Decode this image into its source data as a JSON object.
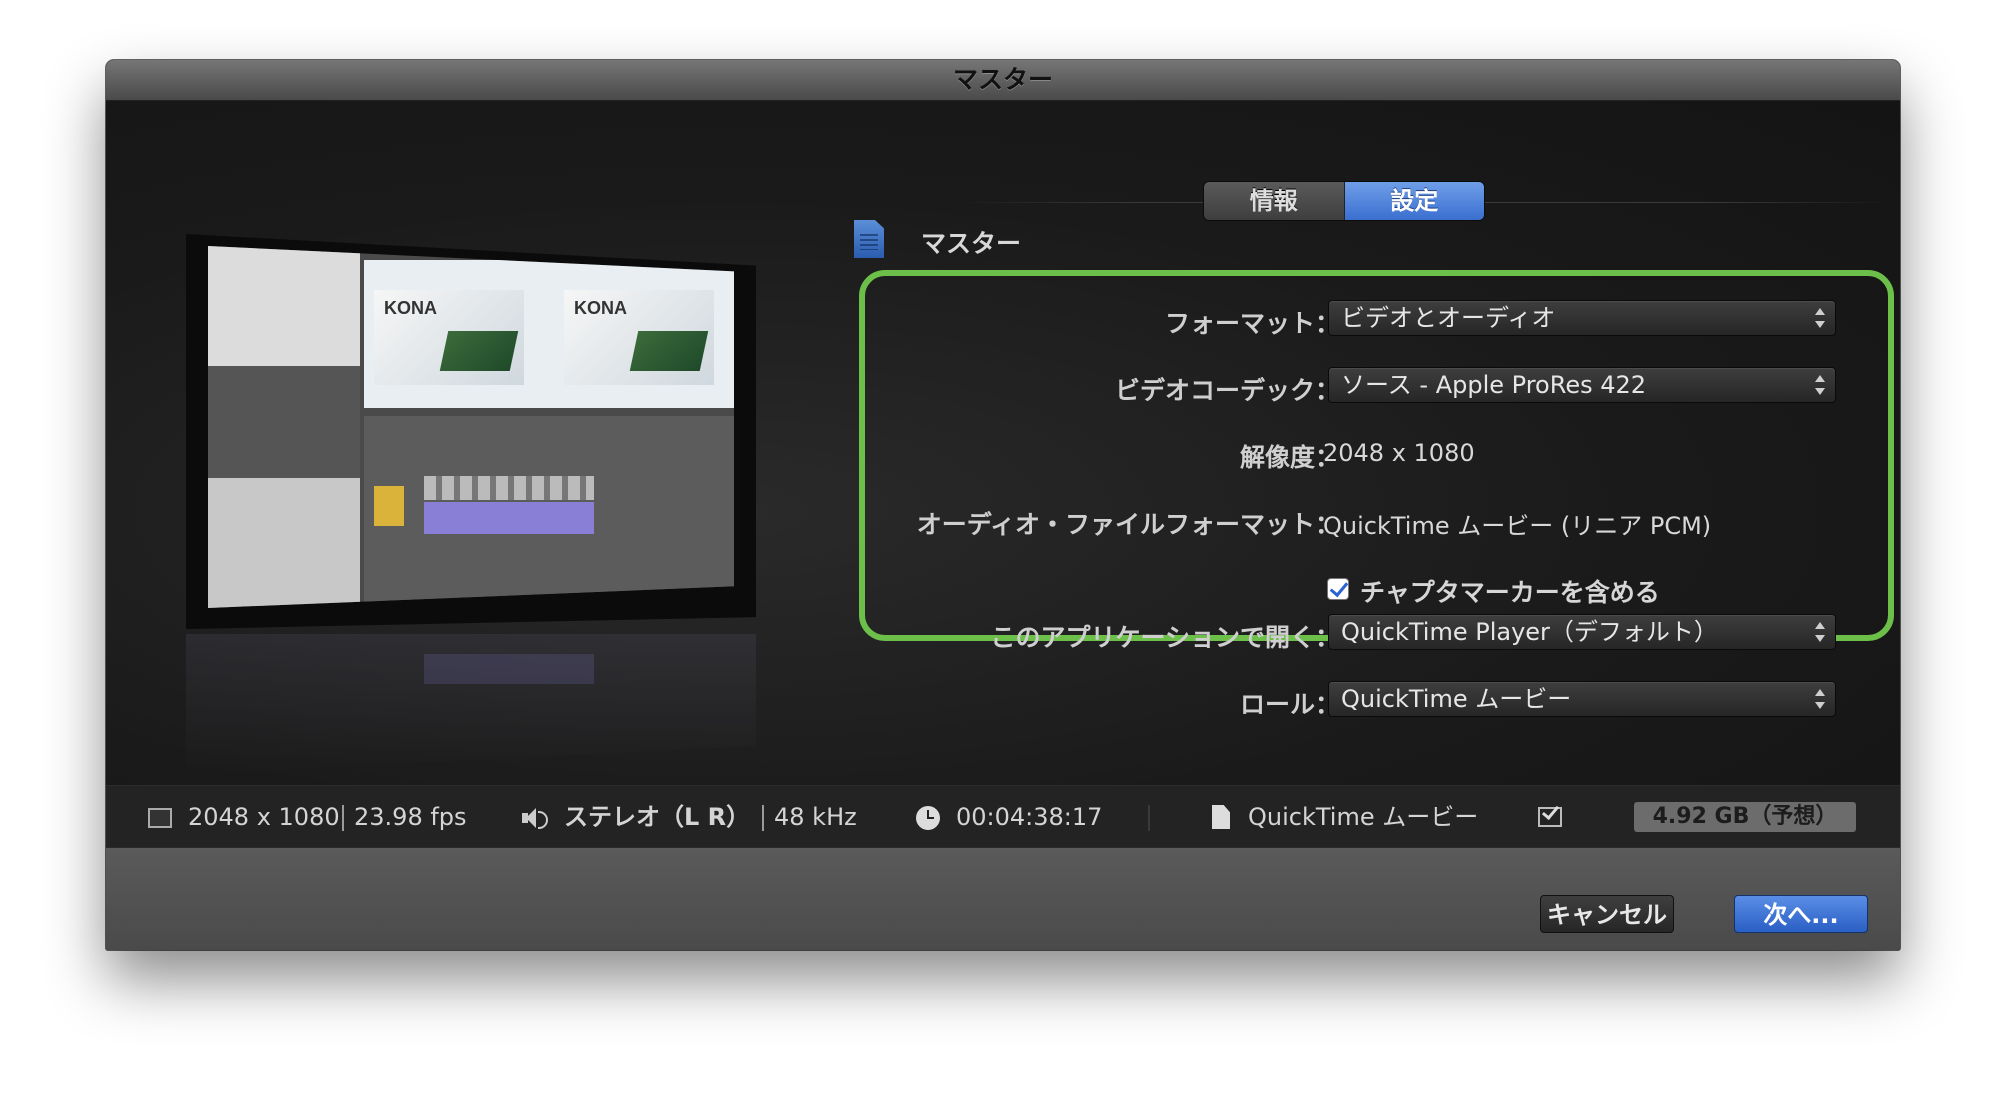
{
  "window": {
    "title": "マスター"
  },
  "tabs": [
    {
      "label": "情報",
      "active": false
    },
    {
      "label": "設定",
      "active": true
    }
  ],
  "preset": {
    "name": "マスター"
  },
  "settings": {
    "format": {
      "label": "フォーマット：",
      "value": "ビデオとオーディオ"
    },
    "video_codec": {
      "label": "ビデオコーデック：",
      "value": "ソース - Apple ProRes 422"
    },
    "resolution": {
      "label": "解像度：",
      "value": "2048 x 1080"
    },
    "audio_file_format": {
      "label": "オーディオ・ファイルフォーマット：",
      "value": "QuickTime ムービー (リニア PCM)"
    },
    "chapter_markers": {
      "label": "チャプタマーカーを含める",
      "checked": true
    },
    "open_with": {
      "label": "このアプリケーションで開く：",
      "value": "QuickTime Player（デフォルト）"
    },
    "role": {
      "label": "ロール：",
      "value": "QuickTime ムービー"
    }
  },
  "info_strip": {
    "resolution": "2048 x 1080",
    "fps": "23.98 fps",
    "audio_channels": "ステレオ（L R）",
    "sample_rate": "48 kHz",
    "duration": "00:04:38:17",
    "file_type": "QuickTime ムービー",
    "estimated_size": "4.92 GB（予想）"
  },
  "buttons": {
    "cancel": "キャンセル",
    "next": "次へ..."
  },
  "preview": {
    "card_title_1": "KONA",
    "card_title_2": "KONA"
  },
  "colors": {
    "highlight_border": "#6cc04a",
    "accent_blue": "#3a6fd0"
  },
  "icons": {
    "preset": "file-icon",
    "resolution": "frame-icon",
    "audio": "speaker-icon",
    "duration": "clock-icon",
    "file_type": "document-icon",
    "compatibility": "checkbox-icon"
  }
}
